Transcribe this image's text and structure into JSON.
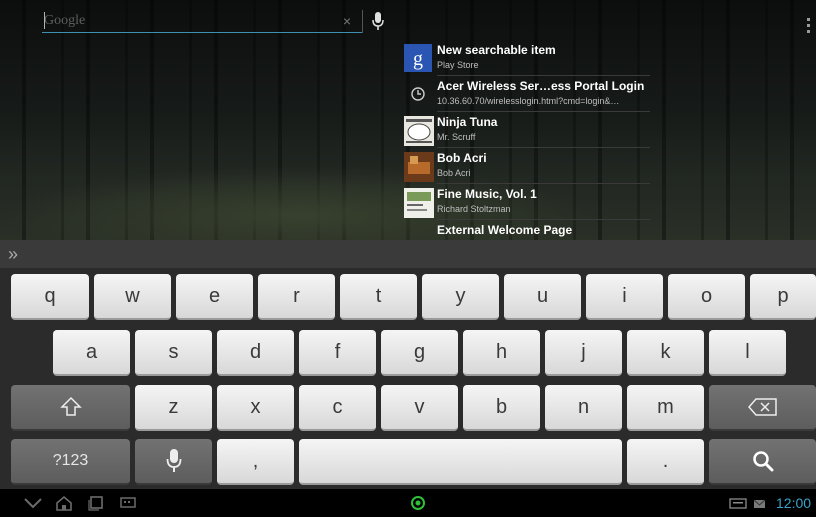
{
  "search": {
    "placeholder": "Google",
    "clear_symbol": "×"
  },
  "suggestions": [
    {
      "title": "New searchable item",
      "subtitle": "Play Store",
      "icon": "google-g-icon"
    },
    {
      "title": "Acer Wireless Ser…ess Portal Login",
      "subtitle": "10.36.60.70/wirelesslogin.html?cmd=login&…",
      "icon": "history-clock-icon"
    },
    {
      "title": "Ninja Tuna",
      "subtitle": "Mr. Scruff",
      "icon": "album-art-ninja-tuna"
    },
    {
      "title": "Bob Acri",
      "subtitle": "Bob Acri",
      "icon": "album-art-bob-acri"
    },
    {
      "title": "Fine Music, Vol. 1",
      "subtitle": "Richard Stoltzman",
      "icon": "album-art-fine-music"
    },
    {
      "title": "External Welcome Page",
      "subtitle": "",
      "icon": "history-icon"
    }
  ],
  "keyboard": {
    "row1": [
      "q",
      "w",
      "e",
      "r",
      "t",
      "y",
      "u",
      "i",
      "o",
      "p"
    ],
    "row2": [
      "a",
      "s",
      "d",
      "f",
      "g",
      "h",
      "j",
      "k",
      "l"
    ],
    "row3": [
      "z",
      "x",
      "c",
      "v",
      "b",
      "n",
      "m"
    ],
    "symbols_label": "?123",
    "comma": ",",
    "period": "."
  },
  "status": {
    "time": "12:00"
  },
  "colors": {
    "accent": "#3aa3c9",
    "key_light": "#eeeeee",
    "key_dark": "#666666",
    "home_dot": "#2fbf3a"
  }
}
